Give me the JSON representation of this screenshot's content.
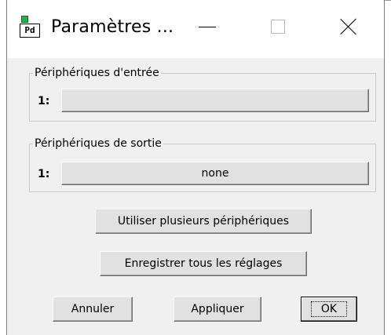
{
  "window": {
    "title": "Paramètres ...",
    "icon_text": "Pd"
  },
  "input_group": {
    "legend": "Périphériques d'entrée",
    "rows": [
      {
        "index": "1:",
        "device": ""
      }
    ]
  },
  "output_group": {
    "legend": "Périphériques de sortie",
    "rows": [
      {
        "index": "1:",
        "device": "none"
      }
    ]
  },
  "buttons": {
    "multiple_devices": "Utiliser plusieurs périphériques",
    "save_all": "Enregistrer tous les réglages",
    "cancel": "Annuler",
    "apply": "Appliquer",
    "ok": "OK"
  },
  "icons": [
    "pd-app-icon",
    "minimize-icon",
    "maximize-icon",
    "close-icon"
  ]
}
